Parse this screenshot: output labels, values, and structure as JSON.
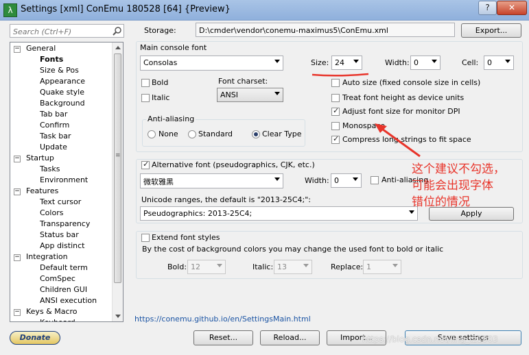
{
  "window": {
    "title": "Settings [xml] ConEmu 180528 [64] {Preview}",
    "app_icon": "λ",
    "help_label": "?",
    "close_label": "✕"
  },
  "search": {
    "placeholder": "Search (Ctrl+F)"
  },
  "tree": {
    "items": [
      {
        "label": "General",
        "level": 0,
        "toggle": "−"
      },
      {
        "label": "Fonts",
        "level": 1,
        "selected": true
      },
      {
        "label": "Size & Pos",
        "level": 1
      },
      {
        "label": "Appearance",
        "level": 1
      },
      {
        "label": "Quake style",
        "level": 1
      },
      {
        "label": "Background",
        "level": 1
      },
      {
        "label": "Tab bar",
        "level": 1
      },
      {
        "label": "Confirm",
        "level": 1
      },
      {
        "label": "Task bar",
        "level": 1
      },
      {
        "label": "Update",
        "level": 1
      },
      {
        "label": "Startup",
        "level": 0,
        "toggle": "−"
      },
      {
        "label": "Tasks",
        "level": 1
      },
      {
        "label": "Environment",
        "level": 1
      },
      {
        "label": "Features",
        "level": 0,
        "toggle": "−"
      },
      {
        "label": "Text cursor",
        "level": 1
      },
      {
        "label": "Colors",
        "level": 1
      },
      {
        "label": "Transparency",
        "level": 1
      },
      {
        "label": "Status bar",
        "level": 1
      },
      {
        "label": "App distinct",
        "level": 1
      },
      {
        "label": "Integration",
        "level": 0,
        "toggle": "−"
      },
      {
        "label": "Default term",
        "level": 1
      },
      {
        "label": "ComSpec",
        "level": 1
      },
      {
        "label": "Children GUI",
        "level": 1
      },
      {
        "label": "ANSI execution",
        "level": 1
      },
      {
        "label": "Keys & Macro",
        "level": 0,
        "toggle": "−"
      },
      {
        "label": "Keyboard",
        "level": 1
      }
    ]
  },
  "storage": {
    "label": "Storage:",
    "path": "D:\\cmder\\vendor\\conemu-maximus5\\ConEmu.xml",
    "export_label": "Export..."
  },
  "main_font": {
    "group_label": "Main console font",
    "font": "Consolas",
    "size_label": "Size:",
    "size": "24",
    "width_label": "Width:",
    "width": "0",
    "cell_label": "Cell:",
    "cell": "0",
    "bold_label": "Bold",
    "italic_label": "Italic",
    "charset_label": "Font charset:",
    "charset": "ANSI",
    "antialias": {
      "label": "Anti-aliasing",
      "none": "None",
      "standard": "Standard",
      "cleartype": "Clear Type"
    },
    "auto_size": "Auto size (fixed console size in cells)",
    "treat_height": "Treat font height as device units",
    "adjust_dpi": "Adjust font size for monitor DPI",
    "monospace": "Monospace",
    "compress": "Compress long strings to fit space"
  },
  "alt_font": {
    "label": "Alternative font (pseudographics, CJK, etc.)",
    "font": "微软雅黑",
    "width_label": "Width:",
    "width": "0",
    "antialias_label": "Anti-aliasing",
    "ranges_label": "Unicode ranges, the default is \"2013-25C4;\":",
    "ranges": "Pseudographics: 2013-25C4;",
    "apply_label": "Apply"
  },
  "font_styles": {
    "label": "Extend font styles",
    "desc": "By the cost of background colors you may change the used font to bold or italic",
    "bold_label": "Bold:",
    "bold": "12",
    "italic_label": "Italic:",
    "italic": "13",
    "replace_label": "Replace:",
    "replace": "1"
  },
  "footer": {
    "link": "https://conemu.github.io/en/SettingsMain.html",
    "donate_label": "Donate",
    "reset_label": "Reset...",
    "reload_label": "Reload...",
    "import_label": "Import...",
    "save_label": "Save settings"
  },
  "annotation": {
    "lines": [
      "这个建议不勾选，",
      "可能会出现字体",
      "错位的情况"
    ],
    "color": "#e8342a"
  },
  "watermark": "https://blog.csdn.net/ling_tz1803"
}
